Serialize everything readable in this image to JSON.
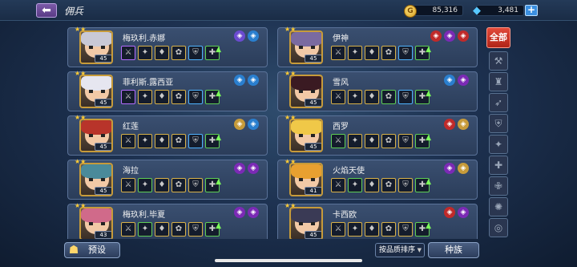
{
  "header": {
    "back_icon": "back-arrow-icon",
    "title": "佣兵",
    "gold": "85,316",
    "diamonds": "3,481"
  },
  "heroes": [
    {
      "name": "梅玖利.赤娜",
      "level": "45",
      "stars": 2,
      "col": 0,
      "row": 0,
      "hair": "#c9c9d6",
      "classes": [
        "#6b4bd0",
        "#2a7fcf"
      ],
      "gear": [
        "purple",
        "gold",
        "gold",
        "gold",
        "blue",
        "green"
      ]
    },
    {
      "name": "伊神",
      "level": "45",
      "stars": 2,
      "col": 1,
      "row": 0,
      "hair": "#7a6aa0",
      "classes": [
        "#c02a2a",
        "#7b2ab5",
        "#c02a2a"
      ],
      "gear": [
        "gold",
        "gold",
        "gold",
        "gold",
        "blue",
        "green"
      ]
    },
    {
      "name": "菲利斯.露西亚",
      "level": "45",
      "stars": 2,
      "col": 0,
      "row": 1,
      "hair": "#e6e6f0",
      "classes": [
        "#2a7fcf",
        "#2a7fcf"
      ],
      "gear": [
        "purple",
        "gold",
        "gold",
        "gold",
        "blue",
        "green"
      ]
    },
    {
      "name": "雪风",
      "level": "45",
      "stars": 2,
      "col": 1,
      "row": 1,
      "hair": "#3a1a22",
      "classes": [
        "#2a7fcf",
        "#7b2ab5"
      ],
      "gear": [
        "gold",
        "gold",
        "gold",
        "green",
        "blue",
        "green"
      ]
    },
    {
      "name": "红莲",
      "level": "45",
      "stars": 2,
      "col": 0,
      "row": 2,
      "hair": "#b8342a",
      "classes": [
        "#c79b3a",
        "#2a7fcf"
      ],
      "gear": [
        "gold",
        "gold",
        "gold",
        "gold",
        "blue",
        "green"
      ]
    },
    {
      "name": "西罗",
      "level": "45",
      "stars": 2,
      "col": 1,
      "row": 2,
      "hair": "#f0c848",
      "classes": [
        "#c02a2a",
        "#c79b3a"
      ],
      "gear": [
        "green",
        "gold",
        "gold",
        "gold",
        "gold",
        "green"
      ]
    },
    {
      "name": "海拉",
      "level": "45",
      "stars": 2,
      "col": 0,
      "row": 3,
      "hair": "#4a8a9a",
      "classes": [
        "#7b2ab5",
        "#7b2ab5"
      ],
      "gear": [
        "gold",
        "green",
        "gold",
        "gold",
        "gold",
        "green"
      ]
    },
    {
      "name": "火焰天使",
      "level": "41",
      "stars": 2,
      "col": 1,
      "row": 3,
      "hair": "#e8a030",
      "classes": [
        "#7b2ab5",
        "#c79b3a"
      ],
      "gear": [
        "gold",
        "green",
        "gold",
        "gold",
        "gold",
        "green"
      ]
    },
    {
      "name": "梅玖利.毕夏",
      "level": "43",
      "stars": 2,
      "col": 0,
      "row": 4,
      "hair": "#d06a8a",
      "classes": [
        "#7b2ab5",
        "#7b2ab5"
      ],
      "gear": [
        "gold",
        "green",
        "gold",
        "gold",
        "gold",
        "green"
      ]
    },
    {
      "name": "卡西欧",
      "level": "45",
      "stars": 2,
      "col": 1,
      "row": 4,
      "hair": "#3a3a55",
      "classes": [
        "#c02a2a",
        "#7b2ab5"
      ],
      "gear": [
        "gold",
        "gold",
        "gold",
        "gold",
        "gold",
        "green"
      ]
    }
  ],
  "sidebar": {
    "all_label": "全部",
    "filters": [
      "warrior-icon",
      "tank-icon",
      "archer-icon",
      "shield-icon",
      "assassin-icon",
      "support-icon",
      "healer-icon",
      "mage-icon",
      "target-icon"
    ]
  },
  "footer": {
    "preset_label": "预设",
    "sort_value": "按品质排序",
    "race_label": "种族"
  }
}
